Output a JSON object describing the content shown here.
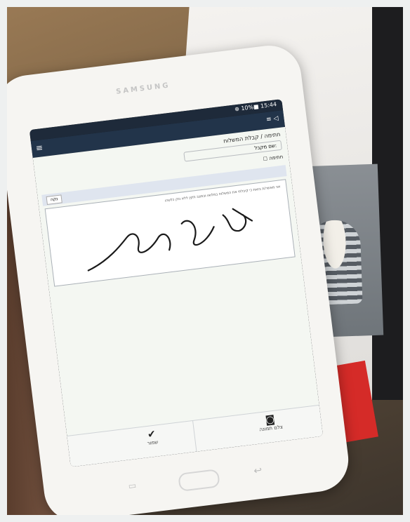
{
  "photo": {
    "device_brand": "SAMSUNG",
    "status_bar": {
      "icons_and_time": "⊕ 10%■ 15:44"
    },
    "app_bar": {
      "menu_icon": "hamburger-menu-icon",
      "title": "≡ ◁"
    },
    "form": {
      "title_line": "חתימה / קבלת המשלוח",
      "field_text": "שם מקבל: ",
      "checkbox_label": "☐ חתימה",
      "clear_label": "נקה",
      "signature_caption": "אני מאשר/ת בזאת כי קיבלתי את המשלוח במלואו ובמצב תקין ללא נזק כלשהו"
    },
    "bottom_bar": {
      "save_label": "שמור",
      "camera_label": "צלם תמונה"
    },
    "colors": {
      "app_bar": "#22344a",
      "screen_bg": "#f4f7f2",
      "tablet_body": "#f6f5f2",
      "red_card": "#d52b28"
    }
  }
}
